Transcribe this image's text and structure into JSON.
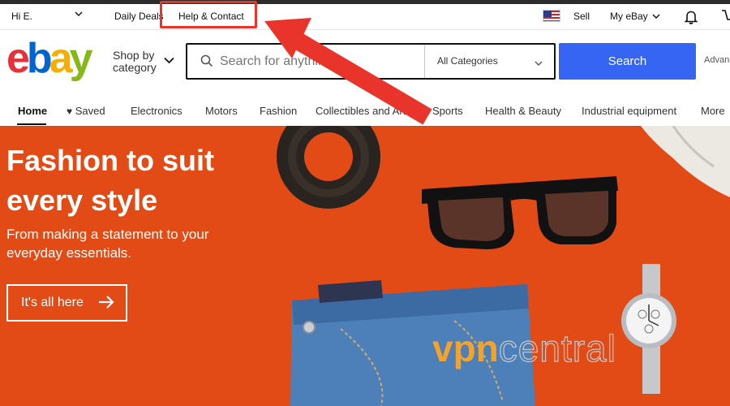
{
  "topbar": {
    "greeting": "Hi E.",
    "daily_deals": "Daily Deals",
    "help_contact": "Help & Contact",
    "sell": "Sell",
    "my_ebay": "My eBay"
  },
  "header": {
    "logo": {
      "e": "e",
      "b": "b",
      "a": "a",
      "y": "y"
    },
    "shop_by_line1": "Shop by",
    "shop_by_line2": "category",
    "search_placeholder": "Search for anything",
    "category_selected": "All Categories",
    "search_button": "Search",
    "advanced": "Advanced"
  },
  "nav": {
    "items": [
      "Home",
      "Saved",
      "Electronics",
      "Motors",
      "Fashion",
      "Collectibles and Art",
      "Sports",
      "Health & Beauty",
      "Industrial equipment",
      "More"
    ]
  },
  "hero": {
    "title": "Fashion to suit every style",
    "subtitle": "From making a statement to your everyday essentials.",
    "cta": "It's all here"
  },
  "watermark": {
    "part1": "vpn",
    "part2": "central"
  },
  "colors": {
    "search_button": "#3665f3",
    "hero_background": "#e24a16",
    "annotation_red": "#e8342a",
    "logo_e": "#e53238",
    "logo_b": "#0064d2",
    "logo_a": "#f5af02",
    "logo_y": "#86b817"
  }
}
